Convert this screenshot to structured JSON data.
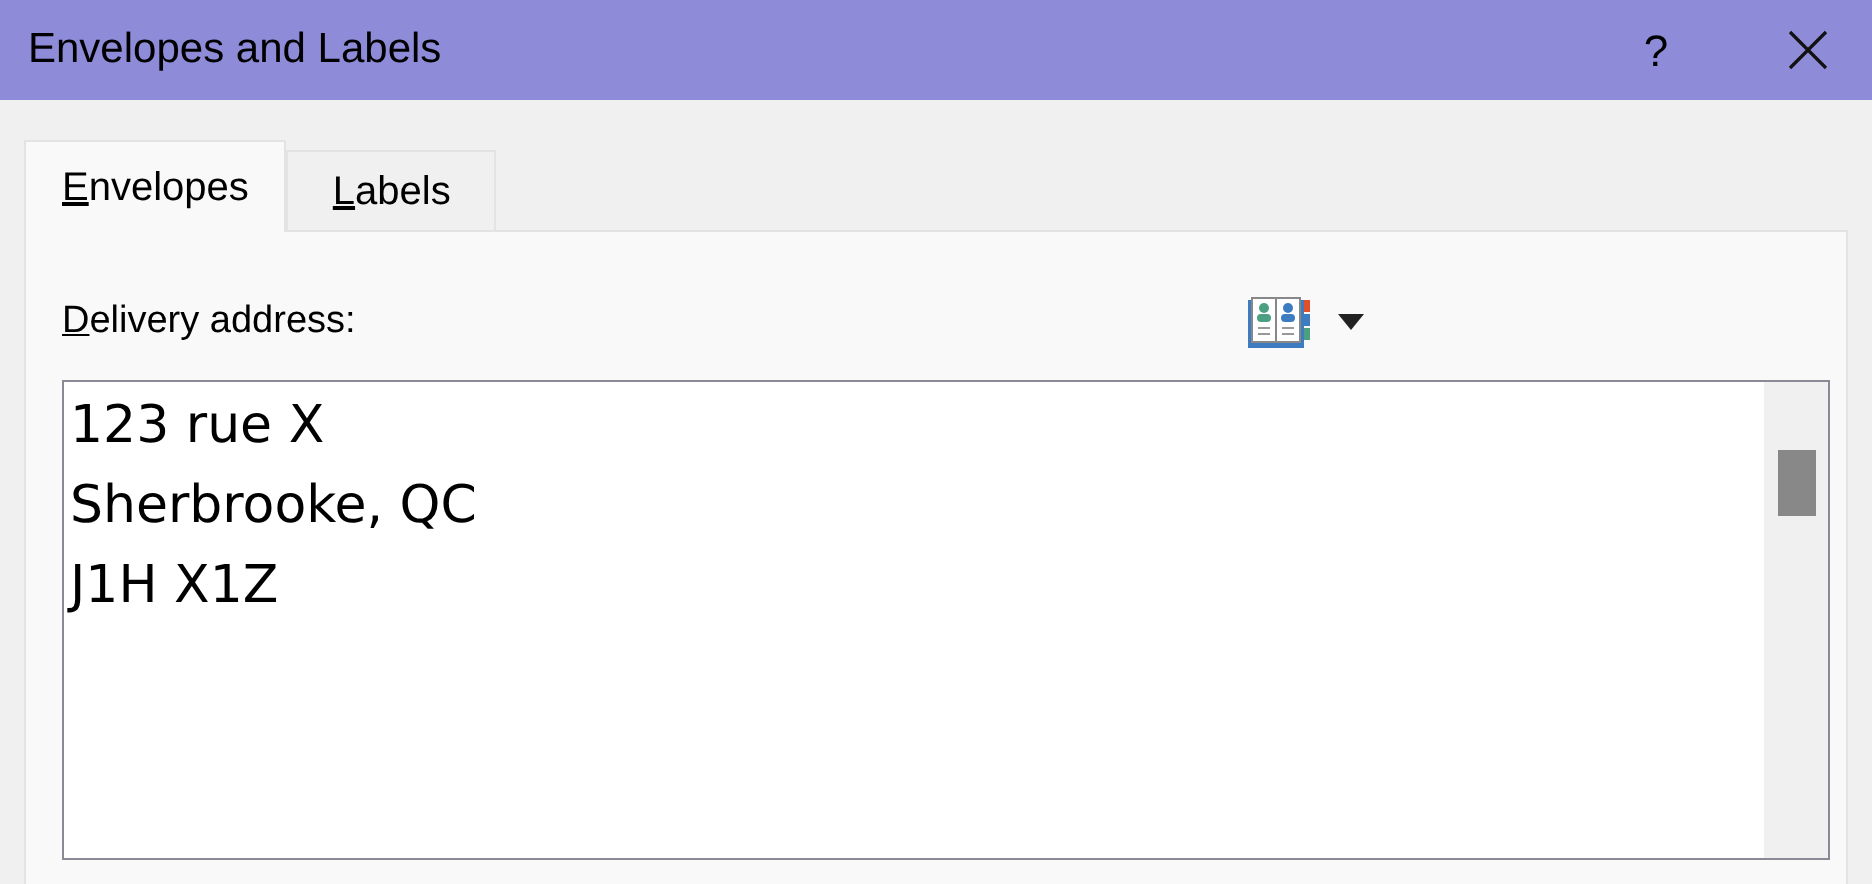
{
  "window": {
    "title": "Envelopes and Labels",
    "help": "?"
  },
  "tabs": [
    {
      "access_key": "E",
      "rest": "nvelopes",
      "selected": true
    },
    {
      "access_key": "L",
      "rest": "abels",
      "selected": false
    }
  ],
  "delivery_address": {
    "label_key": "D",
    "label_rest": "elivery address:",
    "value": "123 rue X\nSherbrooke, QC\nJ1H X1Z"
  }
}
